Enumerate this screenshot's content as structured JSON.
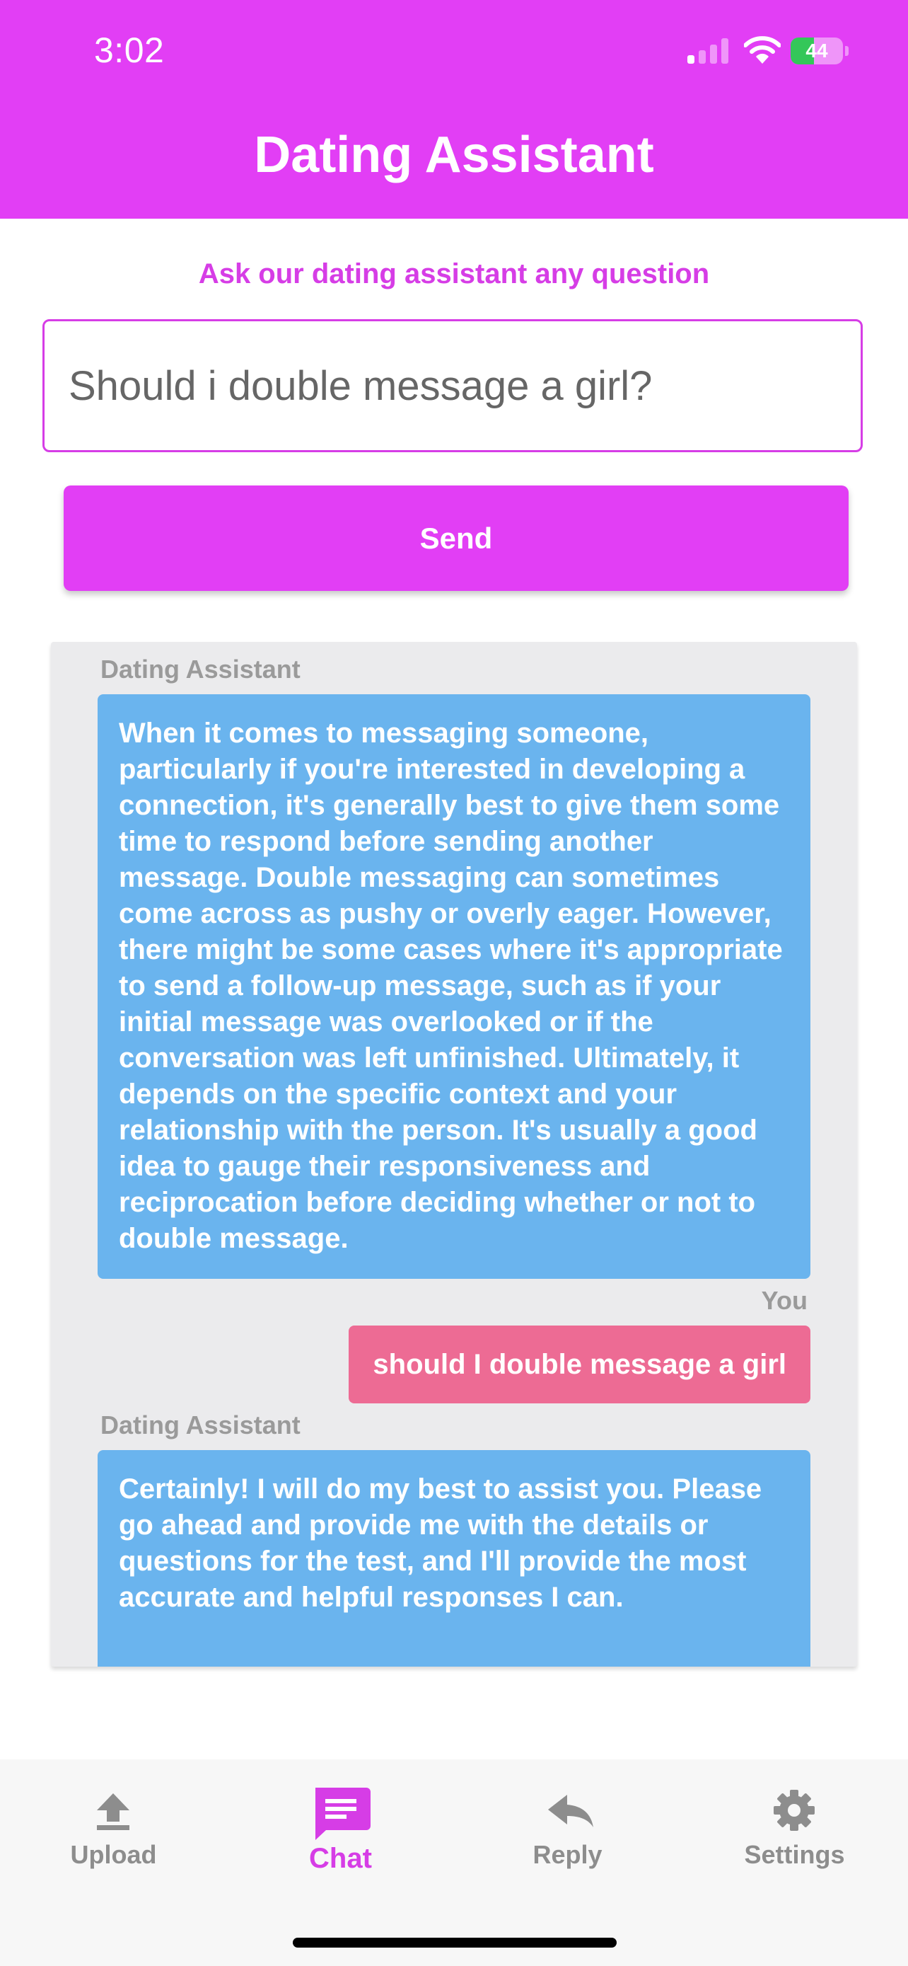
{
  "status_bar": {
    "time": "3:02",
    "battery": "44",
    "signal_bars_active": 1,
    "icons": [
      "cellular-signal-icon",
      "wifi-icon",
      "battery-icon"
    ]
  },
  "header": {
    "title": "Dating Assistant"
  },
  "composer": {
    "prompt": "Ask our dating assistant any question",
    "input_value": "Should i double message a girl?",
    "send_label": "Send"
  },
  "chat": {
    "messages": [
      {
        "sender": "Dating Assistant",
        "text": "When it comes to messaging someone, particularly if you're interested in developing a connection, it's generally best to give them some time to respond before sending another message. Double messaging can sometimes come across as pushy or overly eager. However, there might be some cases where it's appropriate to send a follow-up message, such as if your initial message was overlooked or if the conversation was left unfinished. Ultimately, it depends on the specific context and your relationship with the person. It's usually a good idea to gauge their responsiveness and reciprocation before deciding whether or not to double message."
      },
      {
        "sender": "You",
        "text": "should I double message a girl"
      },
      {
        "sender": "Dating Assistant",
        "text": "Certainly! I will do my best to assist you. Please go ahead and provide me with the details or questions for the test, and I'll provide the most accurate and helpful responses I can."
      }
    ]
  },
  "tabs": [
    {
      "label": "Upload",
      "icon": "upload-icon",
      "active": false
    },
    {
      "label": "Chat",
      "icon": "chat-icon",
      "active": true
    },
    {
      "label": "Reply",
      "icon": "reply-icon",
      "active": false
    },
    {
      "label": "Settings",
      "icon": "settings-gear-icon",
      "active": false
    }
  ],
  "colors": {
    "brand": "#e23ef5",
    "assistant_bubble": "#6ab4ee",
    "user_bubble": "#ed6b94",
    "inactive_tab": "#8d8d8d"
  }
}
